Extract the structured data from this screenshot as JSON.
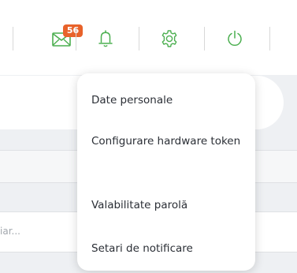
{
  "header": {
    "mail_badge": "56",
    "icons": [
      "mail-icon",
      "bell-icon",
      "gear-icon",
      "power-icon"
    ],
    "icon_color": "#4caf50"
  },
  "search": {
    "placeholder": "iar..."
  },
  "menu": {
    "items": [
      {
        "label": "Date personale"
      },
      {
        "label": "Configurare hardware token"
      },
      {
        "label": "Valabilitate parolă"
      },
      {
        "label": "Setari de notificare"
      }
    ]
  }
}
